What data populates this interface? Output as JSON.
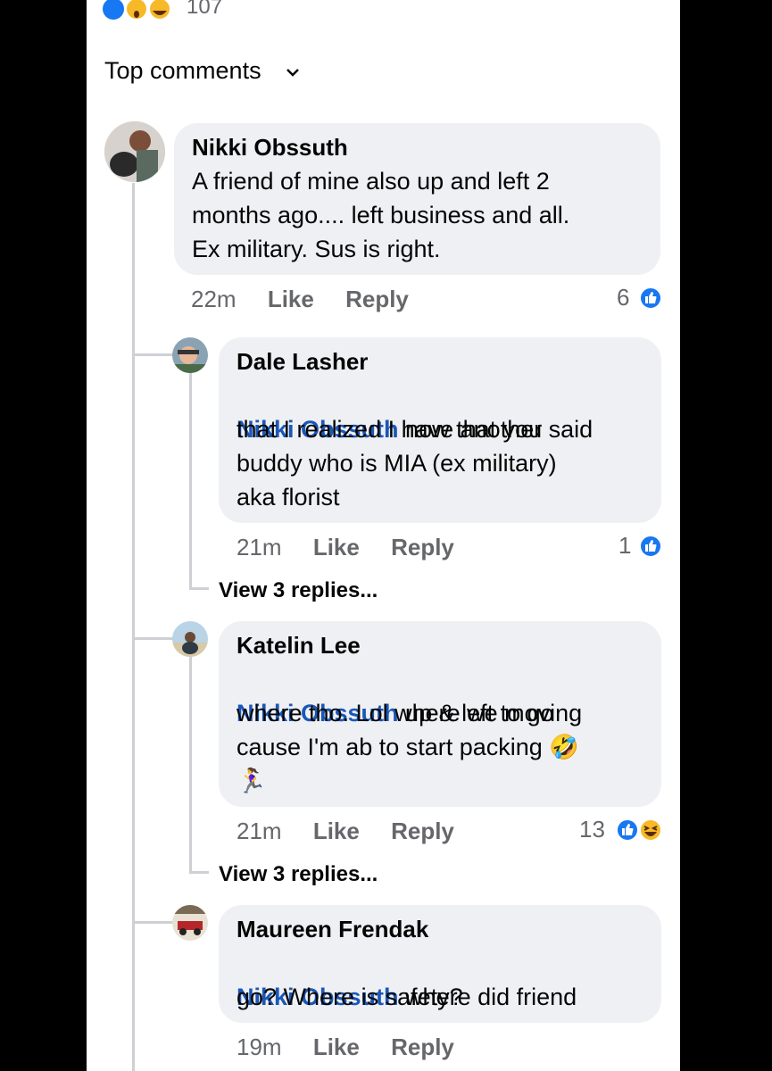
{
  "header": {
    "reaction_count": "107",
    "section_title": "Top comments"
  },
  "comments": [
    {
      "name": "Nikki Obssuth",
      "text": "A friend of mine also up and left 2\nmonths ago.... left business and all.\nEx military.  Sus is right.",
      "time": "22m",
      "like_label": "Like",
      "reply_label": "Reply",
      "reaction_count": "6"
    },
    {
      "name": "Dale Lasher",
      "mention": "Nikki Obssuth",
      "text_first": " now that you said",
      "text_rest": "that I realized I have another\nbuddy who is MIA (ex military)\naka florist",
      "time": "21m",
      "like_label": "Like",
      "reply_label": "Reply",
      "reaction_count": "1",
      "view_replies": "View 3 replies..."
    },
    {
      "name": "Katelin Lee",
      "mention": "Nikki Obssuth",
      "text_first": " up & left to go",
      "text_rest": "where tho. Lol where we moving\ncause I'm ab to start packing 🤣\n🏃‍♀️",
      "time": "21m",
      "like_label": "Like",
      "reply_label": "Reply",
      "reaction_count": "13",
      "view_replies": "View 3 replies..."
    },
    {
      "name": "Maureen Frendak",
      "mention": "Nikki Obssuth",
      "text_first": " where did friend",
      "text_rest": "go? Where is safety?",
      "time": "19m",
      "like_label": "Like",
      "reply_label": "Reply"
    }
  ],
  "colors": {
    "bubble": "#eff0f3",
    "mention": "#1b57b8",
    "meta": "#65676b",
    "like_blue": "#1877f2"
  }
}
